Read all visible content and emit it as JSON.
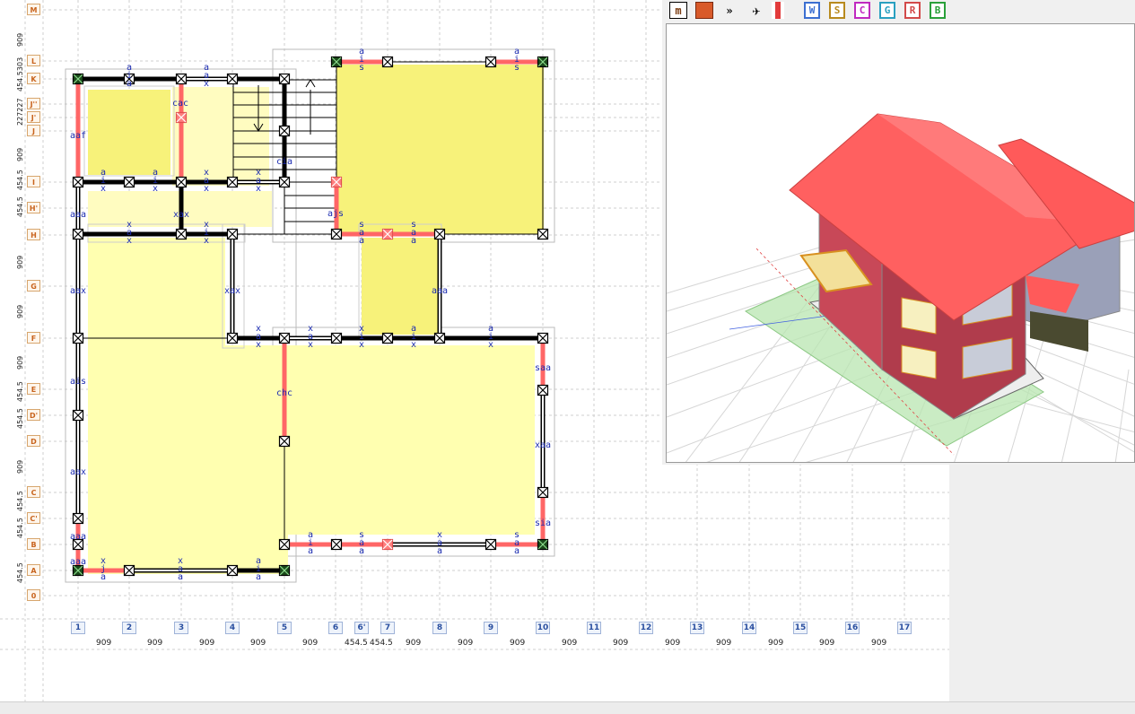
{
  "plan": {
    "rows": [
      {
        "label": "M"
      },
      {
        "label": "L"
      },
      {
        "label": "K"
      },
      {
        "label": "J''"
      },
      {
        "label": "J'"
      },
      {
        "label": "J"
      },
      {
        "label": "I"
      },
      {
        "label": "H'"
      },
      {
        "label": "H"
      },
      {
        "label": "G"
      },
      {
        "label": "F"
      },
      {
        "label": "E"
      },
      {
        "label": "D'"
      },
      {
        "label": "D"
      },
      {
        "label": "C"
      },
      {
        "label": "C'"
      },
      {
        "label": "B"
      },
      {
        "label": "A"
      },
      {
        "label": "0"
      }
    ],
    "columns": [
      {
        "label": "1"
      },
      {
        "label": "2"
      },
      {
        "label": "3"
      },
      {
        "label": "4"
      },
      {
        "label": "5"
      },
      {
        "label": "6"
      },
      {
        "label": "6'"
      },
      {
        "label": "7"
      },
      {
        "label": "8"
      },
      {
        "label": "9"
      },
      {
        "label": "10"
      },
      {
        "label": "11"
      },
      {
        "label": "12"
      },
      {
        "label": "13"
      },
      {
        "label": "14"
      },
      {
        "label": "15"
      },
      {
        "label": "16"
      },
      {
        "label": "17"
      }
    ],
    "bottom_dims": [
      "909",
      "909",
      "909",
      "909",
      "909",
      "454.5",
      "454.5",
      "909",
      "909",
      "909",
      "909",
      "909",
      "909",
      "909",
      "909",
      "909",
      "909"
    ],
    "left_dims": [
      "909",
      "454.5303",
      "227227",
      "909",
      "454.5",
      "454.5",
      "909",
      "909",
      "909",
      "454.5",
      "454.5",
      "909",
      "454.5",
      "454.5",
      "454.5"
    ],
    "wall_codes": {
      "k_top1": "a i a",
      "k_top2": "a a x",
      "l_top1": "a i s",
      "l_top2": "a i s",
      "cac": "cac",
      "aaf": "aaf",
      "cia": "cia",
      "ajs": "ajs",
      "i_row1": "a i x",
      "i_row2": "a i x",
      "i_row3": "x a x",
      "i_row4": "x a x",
      "xax_mid": "xax",
      "aaa_h": "aaa",
      "h_row1": "x a x",
      "h_row2": "x i x",
      "h_row3": "s a a",
      "h_row4": "s a a",
      "aax_g": "aax",
      "xax_g": "xax",
      "aaa_g": "aaa",
      "f_row1": "x a x",
      "f_row2": "x a x",
      "f_row3": "x i x",
      "f_row4": "a i x",
      "f_row5": "a i x",
      "ais_e": "ais",
      "chc": "chc",
      "saa_e": "saa",
      "aax_d": "aax",
      "xaa_d": "xaa",
      "sia_c": "sia",
      "aaa_b": "aaa",
      "aaa_a": "aaa",
      "b_row1": "a i a",
      "b_row2": "s a a",
      "b_row3": "x a a",
      "b_row4": "s a a",
      "a_row1": "x j a",
      "a_row2": "x a a",
      "a_row3": "a i a"
    }
  },
  "toolbar": {
    "buttons": [
      {
        "label": "m",
        "color": "#7a3a10"
      },
      {
        "label": "",
        "color": "#d85a2a"
      },
      {
        "label": "»",
        "color": "#000000"
      },
      {
        "label": "",
        "color": "#000000"
      },
      {
        "label": "",
        "color": "#e23b3b"
      },
      {
        "label": "W",
        "color": "#3b6fd1"
      },
      {
        "label": "S",
        "color": "#b88a1e"
      },
      {
        "label": "C",
        "color": "#c02ac0"
      },
      {
        "label": "G",
        "color": "#2aa0c0"
      },
      {
        "label": "R",
        "color": "#d24a4a"
      },
      {
        "label": "B",
        "color": "#2aa03a"
      }
    ]
  },
  "colors": {
    "room_fill": "#ffffb0",
    "room_fill_dark": "#f7f27a",
    "wall_red": "#ff6666",
    "roof_red": "#ff6060",
    "code_blue": "#1a2ab0"
  }
}
